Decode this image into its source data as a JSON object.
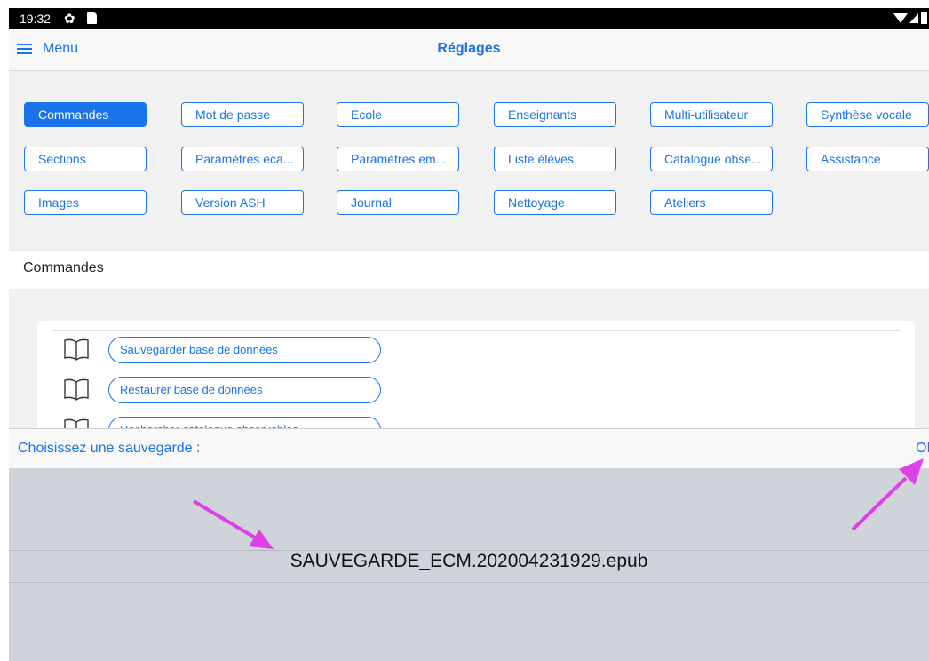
{
  "status": {
    "time": "19:32",
    "icons": [
      "gear-icon",
      "sdcard-icon",
      "wifi-icon",
      "signal-icon",
      "battery-icon"
    ]
  },
  "nav": {
    "menu_label": "Menu",
    "title": "Réglages"
  },
  "tabs": [
    {
      "label": "Commandes",
      "active": true
    },
    {
      "label": "Mot de passe"
    },
    {
      "label": "Ecole"
    },
    {
      "label": "Enseignants"
    },
    {
      "label": "Multi-utilisateur"
    },
    {
      "label": "Synthèse vocale"
    },
    {
      "label": "Sections"
    },
    {
      "label": "Paramètres eca..."
    },
    {
      "label": "Paramètres em..."
    },
    {
      "label": "Liste élèves"
    },
    {
      "label": "Catalogue obse..."
    },
    {
      "label": "Assistance"
    },
    {
      "label": "Images"
    },
    {
      "label": "Version ASH"
    },
    {
      "label": "Journal"
    },
    {
      "label": "Nettoyage"
    },
    {
      "label": "Ateliers"
    }
  ],
  "section": {
    "title": "Commandes"
  },
  "commands": [
    {
      "label": "Sauvegarder base de données"
    },
    {
      "label": "Restaurer base de données"
    },
    {
      "label": "Rechercher catalogue observables"
    }
  ],
  "picker": {
    "label": "Choisissez une sauvegarde :",
    "ok_label": "OK",
    "selected": "SAUVEGARDE_ECM.202004231929.epub"
  },
  "colors": {
    "accent": "#1a73e8",
    "annotation": "#e040e8"
  }
}
